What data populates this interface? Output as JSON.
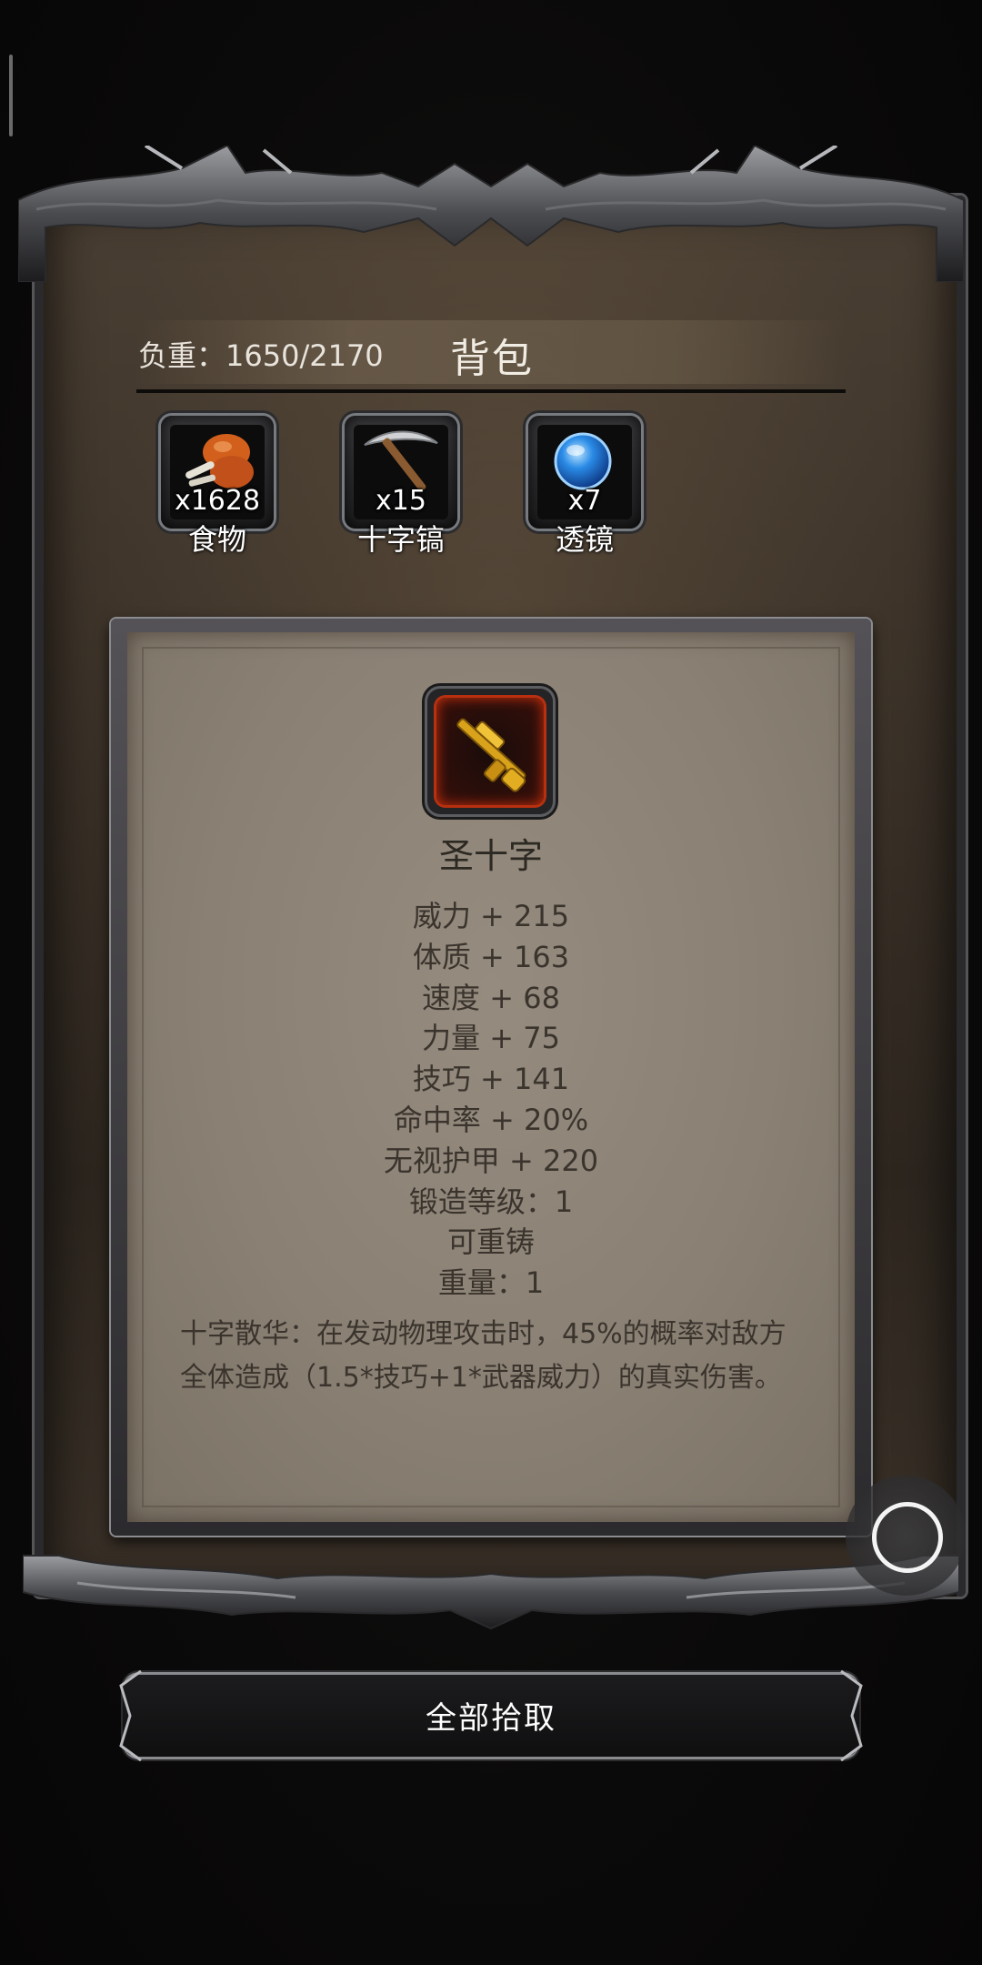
{
  "bag": {
    "weight_text": "负重：1650/2170",
    "title": "背包"
  },
  "items": [
    {
      "name": "食物",
      "count": "x1628",
      "icon": "roast-meat-icon"
    },
    {
      "name": "十字镐",
      "count": "x15",
      "icon": "pickaxe-icon"
    },
    {
      "name": "透镜",
      "count": "x7",
      "icon": "blue-lens-icon"
    }
  ],
  "detail": {
    "icon": "golden-rifle-icon",
    "name": "圣十字",
    "stats": [
      "威力 + 215",
      "体质 + 163",
      "速度 + 68",
      "力量 + 75",
      "技巧 + 141",
      "命中率 + 20%",
      "无视护甲 + 220",
      "锻造等级：1",
      "可重铸",
      "重量：1"
    ],
    "skill": "十字散华：在发动物理攻击时，45%的概率对敌方全体造成（1.5*技巧+1*武器威力）的真实伤害。"
  },
  "actions": {
    "pick_all_label": "全部拾取"
  },
  "colors": {
    "card_bg": "#8a8074",
    "weapon_glow": "#c8310e",
    "panel_bg": "#3e342a"
  }
}
